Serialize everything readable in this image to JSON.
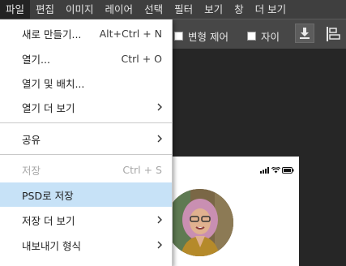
{
  "menubar": {
    "items": [
      "파일",
      "편집",
      "이미지",
      "레이어",
      "선택",
      "필터",
      "보기",
      "창",
      "더 보기"
    ]
  },
  "toolbar": {
    "transform_label": "변형 제어",
    "distance_label": "자이"
  },
  "file_menu": {
    "items": [
      {
        "label": "새로 만들기...",
        "shortcut": "Alt+Ctrl + N"
      },
      {
        "label": "열기...",
        "shortcut": "Ctrl + O"
      },
      {
        "label": "열기 및 배치...",
        "shortcut": ""
      },
      {
        "label": "열기 더 보기",
        "shortcut": ""
      },
      {
        "label": "공유",
        "shortcut": ""
      },
      {
        "label": "저장",
        "shortcut": "Ctrl + S",
        "disabled": true
      },
      {
        "label": "PSD로 저장",
        "shortcut": "",
        "highlighted": true
      },
      {
        "label": "저장 더 보기",
        "shortcut": ""
      },
      {
        "label": "내보내기 형식",
        "shortcut": ""
      }
    ]
  },
  "colors": {
    "menubar_bg": "#3f3f3f",
    "toolbar_bg": "#474747",
    "menu_bg": "#ffffff",
    "highlight_bg": "#c7e2f7",
    "disabled_text": "#a7a7a7"
  }
}
